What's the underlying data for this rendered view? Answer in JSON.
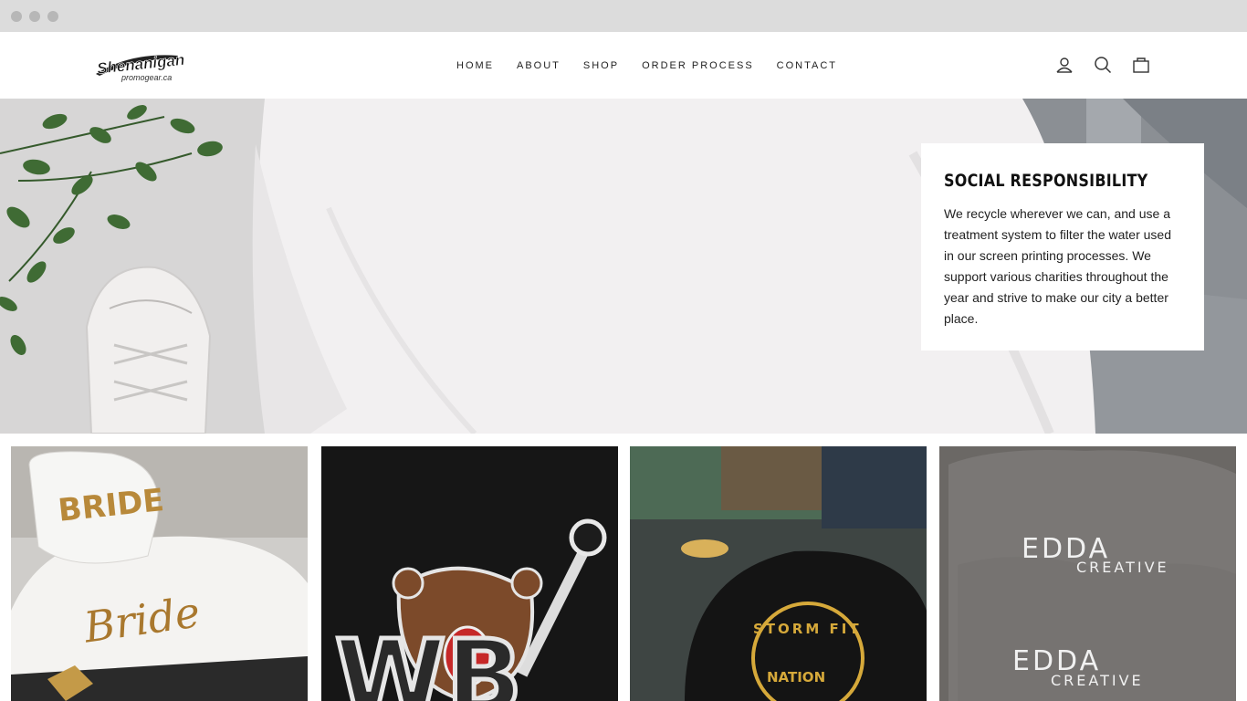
{
  "logo": {
    "text": "Shenanigans",
    "sub": "promogear.ca"
  },
  "nav": [
    "HOME",
    "ABOUT",
    "SHOP",
    "ORDER PROCESS",
    "CONTACT"
  ],
  "icons": [
    "user-icon",
    "search-icon",
    "cart-icon"
  ],
  "promo": {
    "title": "SOCIAL RESPONSIBILITY",
    "body": "We recycle wherever we can, and use a treatment system to filter the water used in our screen printing processes. We support various charities throughout the year and strive to make our city a better place."
  },
  "tiles": {
    "bride": {
      "hat_text": "BRIDE",
      "shirt_text": "Bride"
    },
    "bear": {
      "letters": "WB"
    },
    "cap": {
      "top_text": "STORM FIT",
      "bottom_text": "NATION"
    },
    "edda": {
      "brand": "EDDA",
      "sub": "CREATIVE"
    }
  },
  "colors": {
    "text": "#222222",
    "header_bg": "#ffffff",
    "chrome": "#dcdcdc"
  }
}
